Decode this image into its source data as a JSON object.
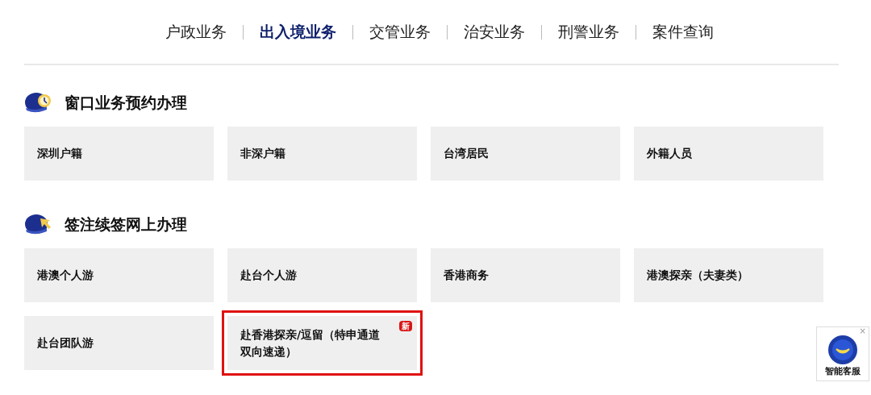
{
  "tabs": [
    {
      "label": "户政业务",
      "selected": false
    },
    {
      "label": "出入境业务",
      "selected": true
    },
    {
      "label": "交管业务",
      "selected": false
    },
    {
      "label": "治安业务",
      "selected": false
    },
    {
      "label": "刑警业务",
      "selected": false
    },
    {
      "label": "案件查询",
      "selected": false
    }
  ],
  "sections": [
    {
      "title": "窗口业务预约办理",
      "items": [
        {
          "label": "深圳户籍",
          "highlighted": false
        },
        {
          "label": "非深户籍",
          "highlighted": false
        },
        {
          "label": "台湾居民",
          "highlighted": false
        },
        {
          "label": "外籍人员",
          "highlighted": false
        }
      ]
    },
    {
      "title": "签注续签网上办理",
      "items": [
        {
          "label": "港澳个人游",
          "highlighted": false
        },
        {
          "label": "赴台个人游",
          "highlighted": false
        },
        {
          "label": "香港商务",
          "highlighted": false
        },
        {
          "label": "港澳探亲（夫妻类）",
          "highlighted": false
        },
        {
          "label": "赴台团队游",
          "highlighted": false
        },
        {
          "label": "赴香港探亲/逗留（特申通道双向速递）",
          "highlighted": true,
          "badge": "新"
        }
      ]
    }
  ],
  "assistant": {
    "label": "智能客服",
    "close": "×"
  }
}
